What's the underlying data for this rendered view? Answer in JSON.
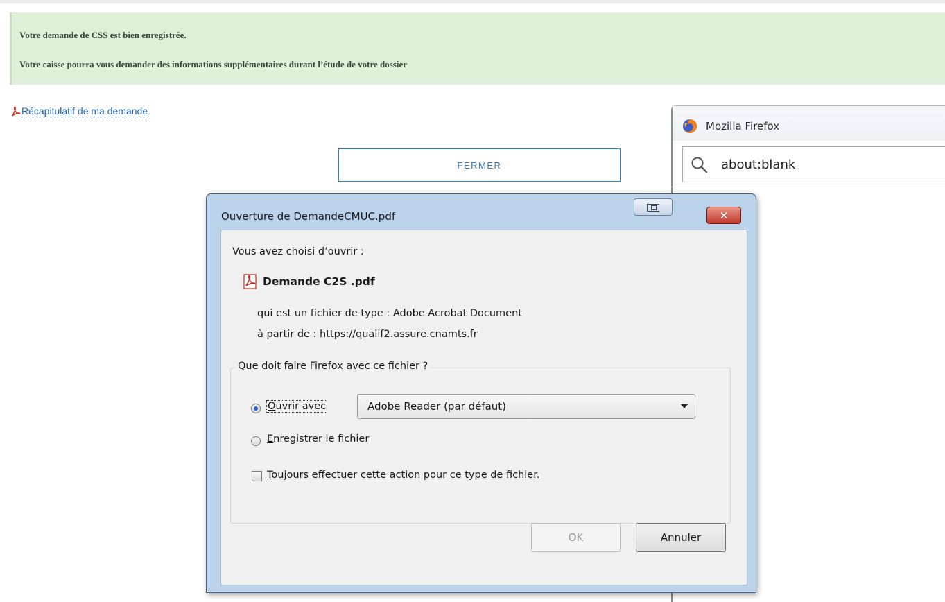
{
  "banner": {
    "line1": "Votre demande de CSS est bien enregistrée.",
    "line2": "Votre caisse pourra vous demander des informations supplémentaires durant l’étude de votre dossier"
  },
  "recap": {
    "link_label": "Récapitulatif de ma demande",
    "icon": "pdf-icon"
  },
  "fermer": {
    "label": "FERMER"
  },
  "firefox_window": {
    "title": "Mozilla Firefox",
    "url": "about:blank",
    "icons": [
      "firefox-logo-icon",
      "search-icon"
    ]
  },
  "dialog": {
    "title": "Ouverture de DemandeCMUC.pdf",
    "chosen_label": "Vous avez choisi d’ouvrir :",
    "file_name": "Demande C2S .pdf",
    "file_type_line": "qui est un fichier de type : Adobe Acrobat Document",
    "from_line": "à partir de : https://qualif2.assure.cnamts.fr",
    "group_legend": "Que doit faire Firefox avec ce fichier ?",
    "open_with": {
      "label": "uvrir avec",
      "mnemonic": "O",
      "selected": true
    },
    "open_with_app": "Adobe Reader  (par défaut)",
    "save_file": {
      "label": "nregistrer le fichier",
      "mnemonic": "E",
      "selected": false
    },
    "always": {
      "label": "oujours effectuer cette action pour ce type de fichier.",
      "mnemonic": "T",
      "checked": false
    },
    "ok_label": "OK",
    "cancel_label": "Annuler",
    "close_glyph": "✕"
  },
  "colors": {
    "banner_bg": "#dff0d8",
    "link": "#2268b8",
    "button_border": "#2a84c8",
    "dialog_frame": "#bcd3ec",
    "close_red": "#c0392b"
  }
}
